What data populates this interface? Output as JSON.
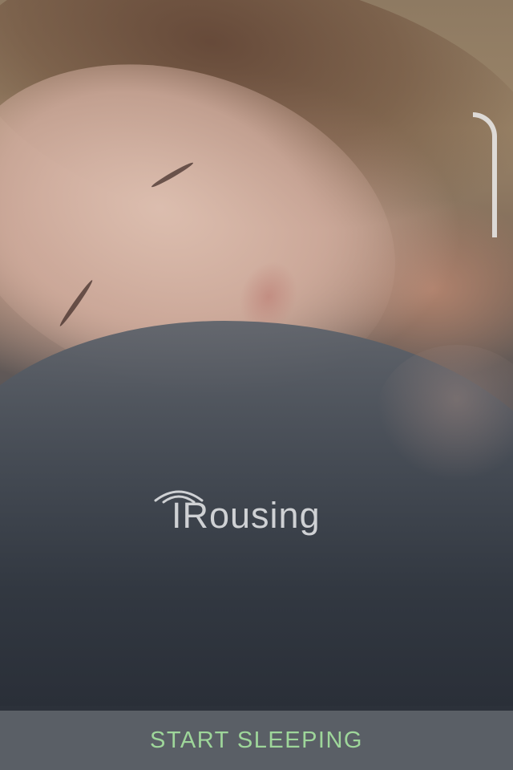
{
  "background": {
    "description_icon": "sleeping-woman-photo"
  },
  "logo": {
    "text": "IRousing",
    "icon": "signal-waves-icon"
  },
  "bottom_bar": {
    "label": "START SLEEPING",
    "label_color": "#9ed69a",
    "bar_color": "#5a5f66"
  }
}
